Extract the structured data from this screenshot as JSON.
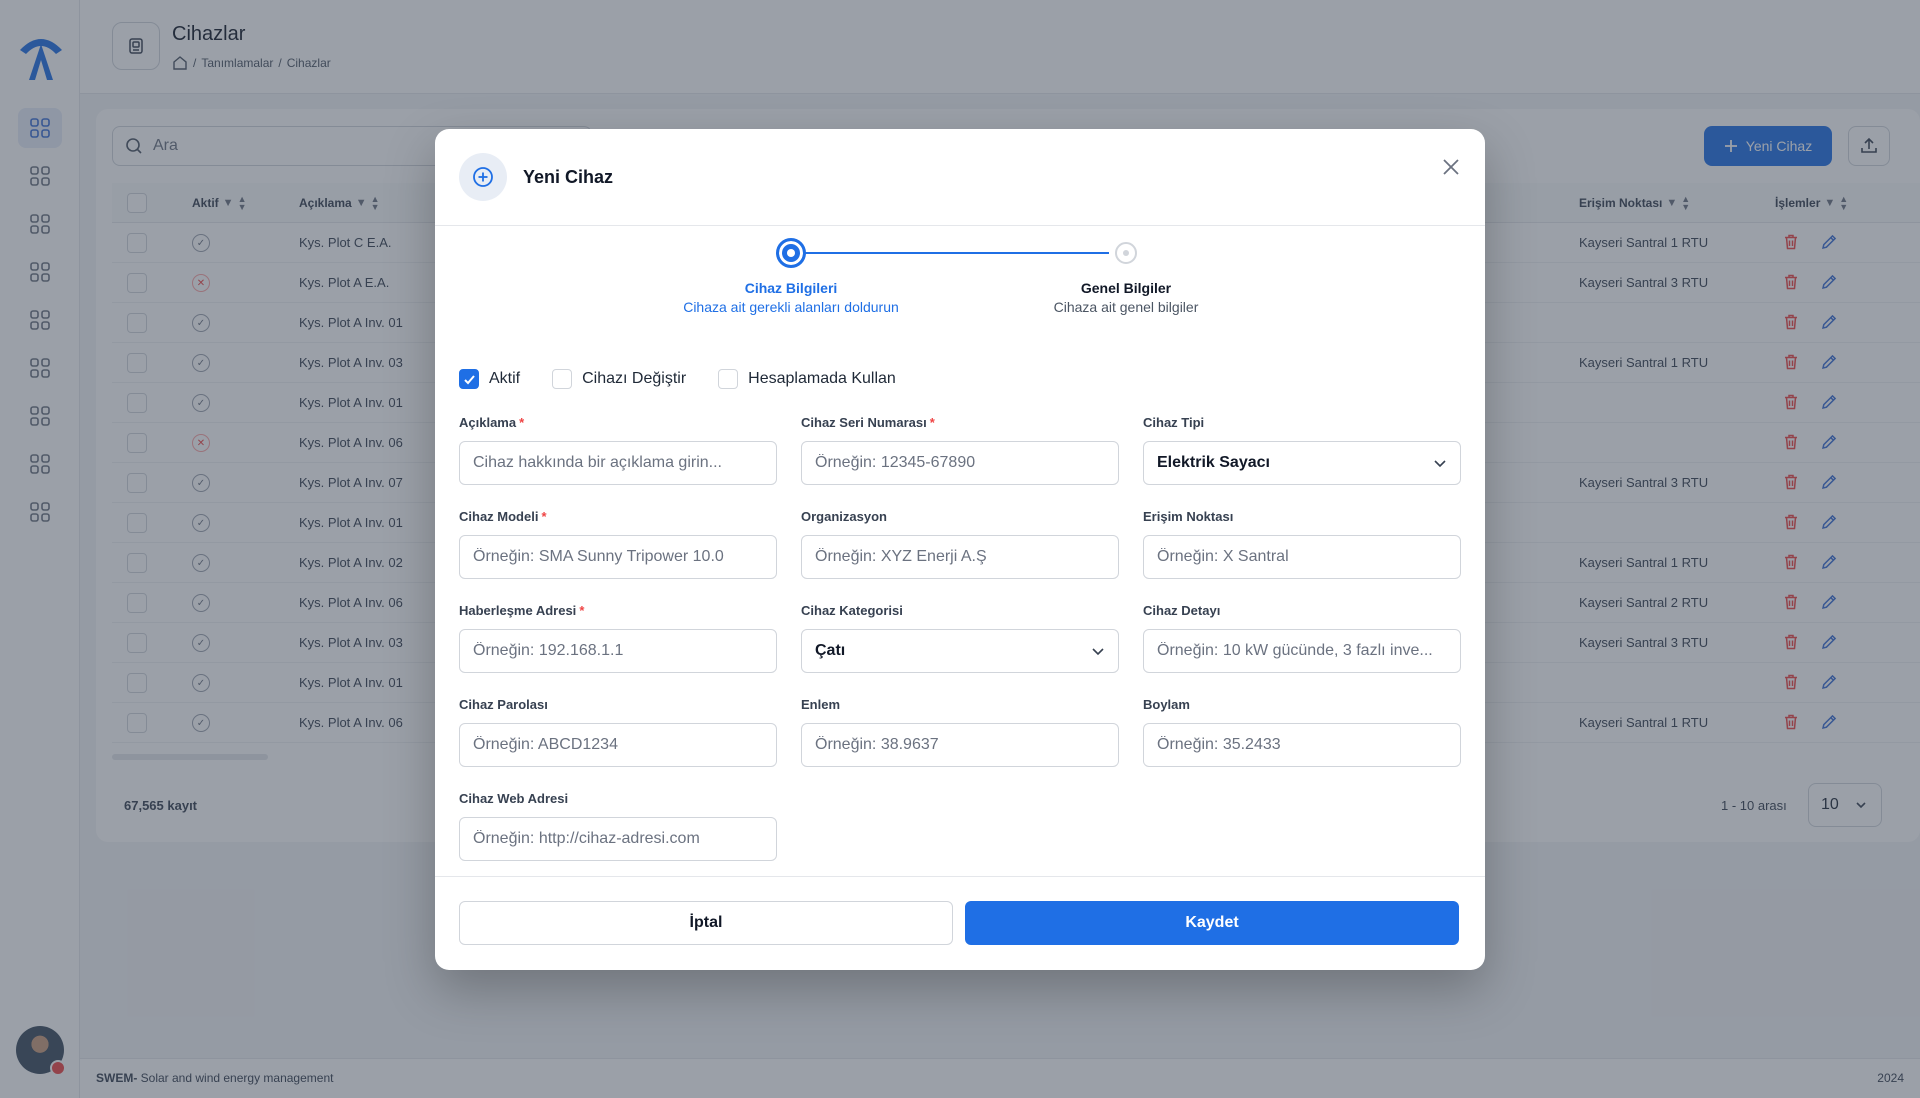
{
  "header": {
    "title": "Cihazlar",
    "breadcrumb": [
      "/",
      "Tanımlamalar",
      "/",
      "Cihazlar"
    ]
  },
  "toolbar": {
    "search_placeholder": "Ara",
    "new_button": "Yeni Cihaz"
  },
  "table": {
    "columns": {
      "active": "Aktif",
      "description": "Açıklama",
      "access_point": "Erişim Noktası",
      "actions": "İşlemler"
    },
    "rows": [
      {
        "active": true,
        "description": "Kys. Plot C E.A.",
        "access_point": "Kayseri Santral 1 RTU"
      },
      {
        "active": false,
        "description": "Kys. Plot A E.A.",
        "access_point": "Kayseri Santral 3 RTU"
      },
      {
        "active": true,
        "description": "Kys. Plot A Inv. 01",
        "access_point": ""
      },
      {
        "active": true,
        "description": "Kys. Plot A Inv. 03",
        "access_point": "Kayseri Santral 1 RTU"
      },
      {
        "active": true,
        "description": "Kys. Plot A Inv. 01",
        "access_point": ""
      },
      {
        "active": false,
        "description": "Kys. Plot A Inv. 06",
        "access_point": ""
      },
      {
        "active": true,
        "description": "Kys. Plot A Inv. 07",
        "access_point": "Kayseri Santral 3 RTU"
      },
      {
        "active": true,
        "description": "Kys. Plot A Inv. 01",
        "access_point": ""
      },
      {
        "active": true,
        "description": "Kys. Plot A Inv. 02",
        "access_point": "Kayseri Santral 1 RTU"
      },
      {
        "active": true,
        "description": "Kys. Plot A Inv. 06",
        "access_point": "Kayseri Santral 2 RTU"
      },
      {
        "active": true,
        "description": "Kys. Plot A Inv. 03",
        "access_point": "Kayseri Santral 3 RTU"
      },
      {
        "active": true,
        "description": "Kys. Plot A Inv. 01",
        "access_point": ""
      },
      {
        "active": true,
        "description": "Kys. Plot A Inv. 06",
        "access_point": "Kayseri Santral 1 RTU"
      }
    ],
    "total": "67,565 kayıt",
    "range": "1 - 10 arası",
    "page_size": "10"
  },
  "footer": {
    "brand": "SWEM-",
    "tagline": " Solar and wind energy management",
    "year": "2024"
  },
  "modal": {
    "title": "Yeni Cihaz",
    "steps": [
      {
        "title": "Cihaz Bilgileri",
        "subtitle": "Cihaza ait gerekli alanları doldurun"
      },
      {
        "title": "Genel Bilgiler",
        "subtitle": "Cihaza ait genel bilgiler"
      }
    ],
    "checkboxes": [
      {
        "label": "Aktif",
        "checked": true
      },
      {
        "label": "Cihazı Değiştir",
        "checked": false
      },
      {
        "label": "Hesaplamada Kullan",
        "checked": false
      }
    ],
    "fields": {
      "aciklama": {
        "label": "Açıklama",
        "placeholder": "Cihaz hakkında bir açıklama girin...",
        "required": "*"
      },
      "seri": {
        "label": "Cihaz Seri Numarası",
        "placeholder": "Örneğin: 12345-67890",
        "required": "*"
      },
      "tip": {
        "label": "Cihaz Tipi",
        "value": "Elektrik Sayacı"
      },
      "model": {
        "label": "Cihaz Modeli",
        "placeholder": "Örneğin: SMA Sunny Tripower 10.0",
        "required": "*"
      },
      "org": {
        "label": "Organizasyon",
        "placeholder": "Örneğin: XYZ Enerji A.Ş"
      },
      "erisim": {
        "label": "Erişim Noktası",
        "placeholder": "Örneğin: X Santral"
      },
      "adres": {
        "label": "Haberleşme Adresi",
        "placeholder": "Örneğin: 192.168.1.1",
        "required": "*"
      },
      "kategori": {
        "label": "Cihaz Kategorisi",
        "value": "Çatı"
      },
      "detay": {
        "label": "Cihaz Detayı",
        "placeholder": "Örneğin: 10 kW gücünde, 3 fazlı inve..."
      },
      "parola": {
        "label": "Cihaz Parolası",
        "placeholder": "Örneğin: ABCD1234"
      },
      "enlem": {
        "label": "Enlem",
        "placeholder": "Örneğin: 38.9637"
      },
      "boylam": {
        "label": "Boylam",
        "placeholder": "Örneğin: 35.2433"
      },
      "web": {
        "label": "Cihaz Web Adresi",
        "placeholder": "Örneğin: http://cihaz-adresi.com"
      }
    },
    "cancel": "İptal",
    "save": "Kaydet"
  },
  "colors": {
    "primary": "#1f6fe5",
    "danger": "#ef4444"
  }
}
